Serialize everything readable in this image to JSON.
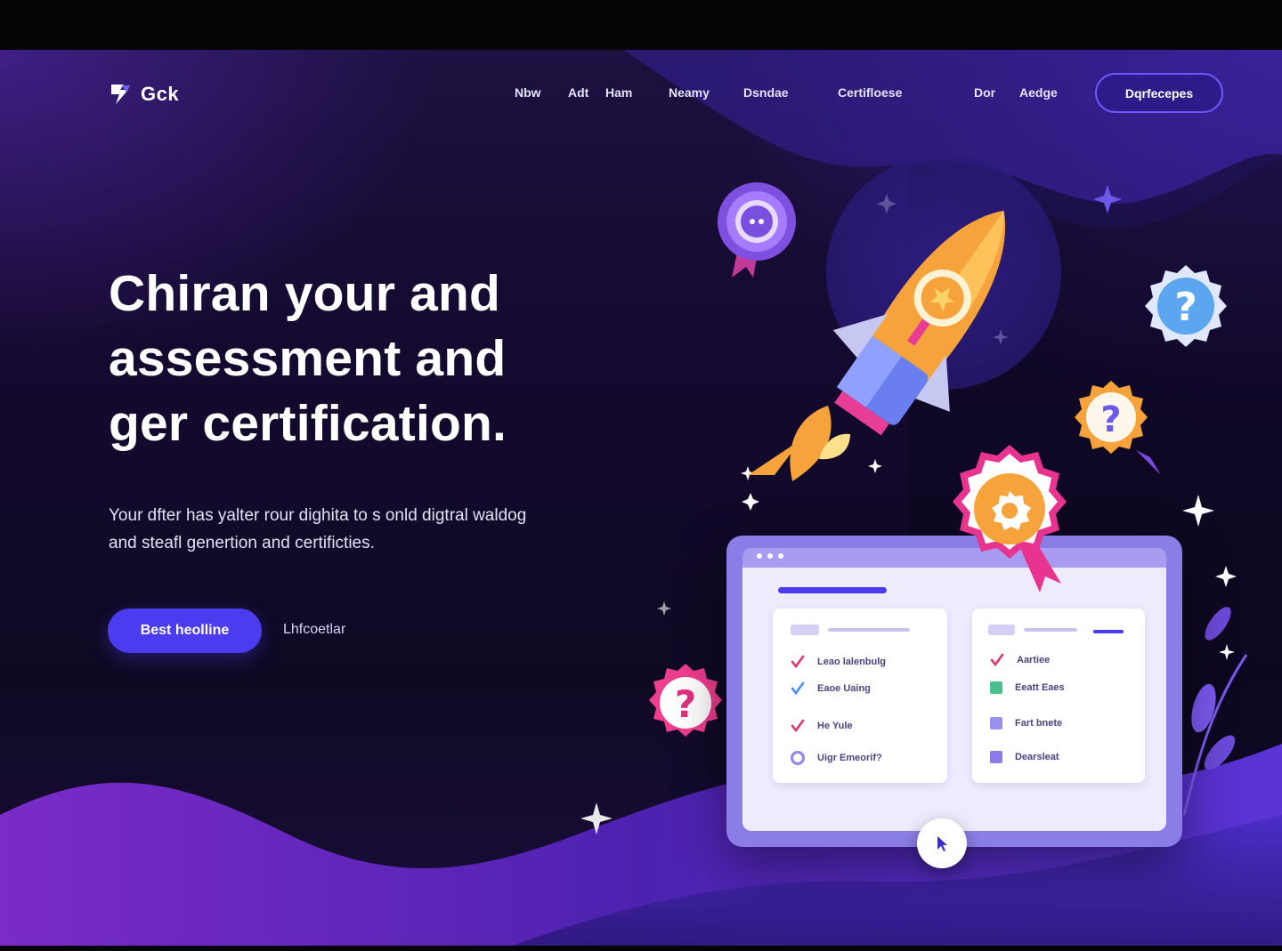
{
  "brand": {
    "name": "Gck",
    "logo_icon": "rocket-flag-icon"
  },
  "nav": {
    "links": [
      "Nbw",
      "Adt",
      "Ham",
      "Neamy",
      "Dsndae",
      "Certifloese",
      "Dor",
      "Aedge"
    ],
    "cta": "Dqrfecepes"
  },
  "hero": {
    "headline": [
      "Chiran your and",
      "assessment and",
      "ger certification."
    ],
    "subtext": [
      "Your dfter has yalter rour dighita to s onld digtral waldog",
      "and steafl genertion and certificties."
    ],
    "primary_button": "Best heolline",
    "secondary_link": "Lhfcoetlar"
  },
  "illustration": {
    "rocket_icon": "rocket-icon",
    "badges": [
      "chat-badge-icon",
      "question-badge-icon",
      "question-badge-icon",
      "question-badge-icon",
      "award-badge-icon"
    ],
    "cursor_icon": "cursor-icon",
    "colors": {
      "accent": "#4b3cf0",
      "orange": "#f5a33a",
      "pink": "#e83d96",
      "panel": "#8b7de6"
    }
  },
  "checklist": {
    "left": [
      {
        "label": "Leao lalenbulg",
        "icon": "check-icon",
        "color": "#e0356b"
      },
      {
        "label": "Eaoe Uaing",
        "icon": "check-icon",
        "color": "#4a8df0"
      },
      {
        "label": "He Yule",
        "icon": "check-icon",
        "color": "#e0356b"
      },
      {
        "label": "Uigr Emeorif?",
        "icon": "circle-icon",
        "color": "#8f86f0"
      }
    ],
    "right": [
      {
        "label": "Aartiee",
        "icon": "check-icon",
        "color": "#e0356b"
      },
      {
        "label": "Eeatt Eaes",
        "icon": "square-icon",
        "color": "#4bc08a"
      },
      {
        "label": "Fart bnete",
        "icon": "square-icon",
        "color": "#9a90ee"
      },
      {
        "label": "Dearsleat",
        "icon": "square-icon",
        "color": "#8a7be6"
      }
    ]
  }
}
